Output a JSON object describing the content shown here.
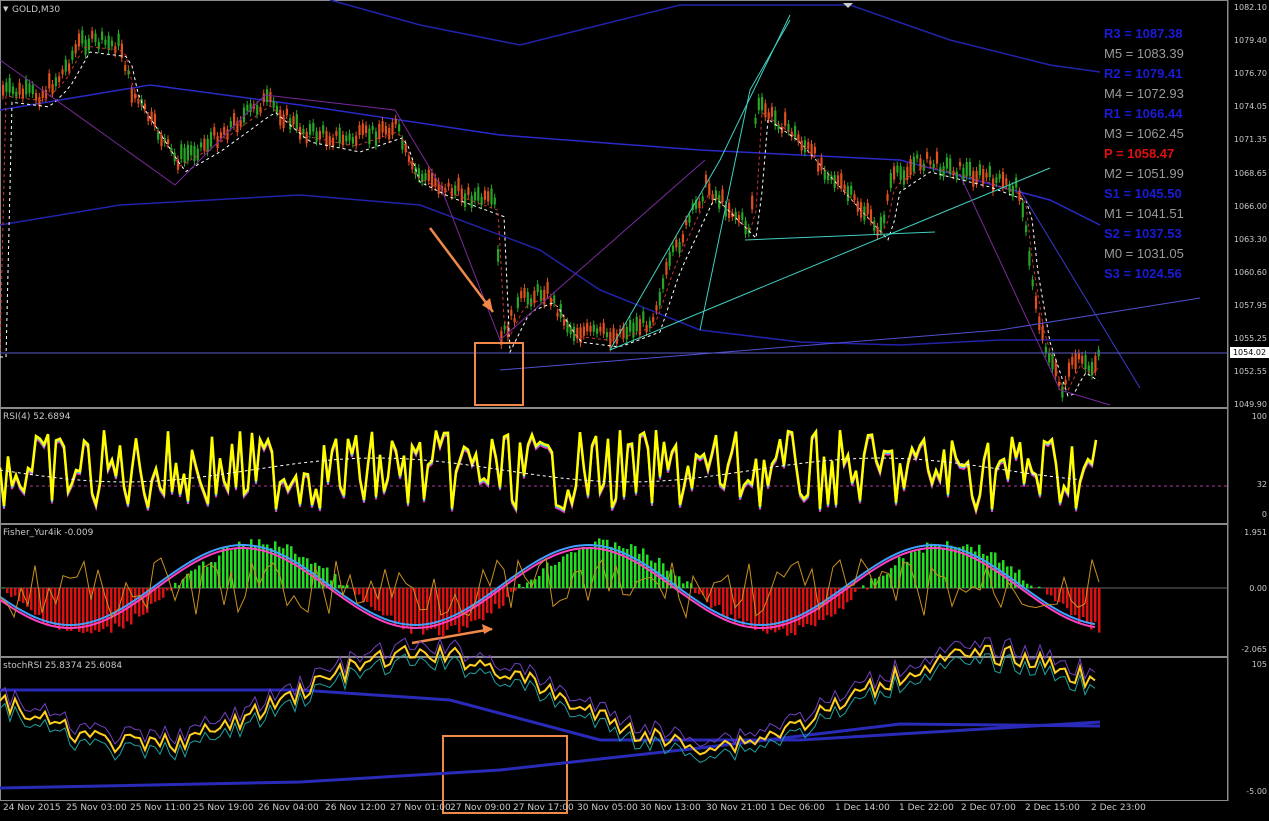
{
  "window": {
    "symbol_title": "GOLD,M30"
  },
  "main_chart": {
    "price_scale": [
      "1082.10",
      "1079.40",
      "1076.70",
      "1074.05",
      "1071.35",
      "1068.65",
      "1066.00",
      "1063.30",
      "1060.60",
      "1057.95",
      "1055.25",
      "1052.55",
      "1049.90"
    ],
    "current_price": "1054.02",
    "pivots": [
      {
        "label": "R3 = 1087.38",
        "color": "#1b1bd6",
        "bold": true
      },
      {
        "label": "M5 = 1083.39",
        "color": "#9a9a9a",
        "bold": false
      },
      {
        "label": "R2 = 1079.41",
        "color": "#1b1bd6",
        "bold": true
      },
      {
        "label": "M4 = 1072.93",
        "color": "#9a9a9a",
        "bold": false
      },
      {
        "label": "R1 = 1066.44",
        "color": "#1b1bd6",
        "bold": true
      },
      {
        "label": "M3 = 1062.45",
        "color": "#9a9a9a",
        "bold": false
      },
      {
        "label": "P  = 1058.47",
        "color": "#e01010",
        "bold": true
      },
      {
        "label": "M2 = 1051.99",
        "color": "#9a9a9a",
        "bold": false
      },
      {
        "label": "S1 = 1045.50",
        "color": "#1b1bd6",
        "bold": true
      },
      {
        "label": "M1 = 1041.51",
        "color": "#9a9a9a",
        "bold": false
      },
      {
        "label": "S2 = 1037.53",
        "color": "#1b1bd6",
        "bold": true
      },
      {
        "label": "M0 = 1031.05",
        "color": "#9a9a9a",
        "bold": false
      },
      {
        "label": "S3 = 1024.56",
        "color": "#1b1bd6",
        "bold": true
      }
    ]
  },
  "rsi_pane": {
    "title": "RSI(4) 52.6894",
    "scale": [
      "100",
      "32",
      "0"
    ]
  },
  "fisher_pane": {
    "title": "Fisher_Yur4ik -0.009",
    "scale": [
      "1.951",
      "0.00",
      "-2.065"
    ]
  },
  "stoch_pane": {
    "title": "stochRSI 25.8374 25.6084",
    "scale": [
      "105",
      "-5.00"
    ]
  },
  "time_axis": [
    "24 Nov 2015",
    "25 Nov 03:00",
    "25 Nov 11:00",
    "25 Nov 19:00",
    "26 Nov 04:00",
    "26 Nov 12:00",
    "27 Nov 01:00",
    "27 Nov 09:00",
    "27 Nov 17:00",
    "30 Nov 05:00",
    "30 Nov 13:00",
    "30 Nov 21:00",
    "1 Dec 06:00",
    "1 Dec 14:00",
    "1 Dec 22:00",
    "2 Dec 07:00",
    "2 Dec 15:00",
    "2 Dec 23:00"
  ],
  "colors": {
    "bull": "#26a526",
    "bear": "#e0501e",
    "highlight": "#f0884a",
    "rsi": "#ffff00",
    "fisher_pos": "#22dd22",
    "fisher_neg": "#dd1111"
  }
}
